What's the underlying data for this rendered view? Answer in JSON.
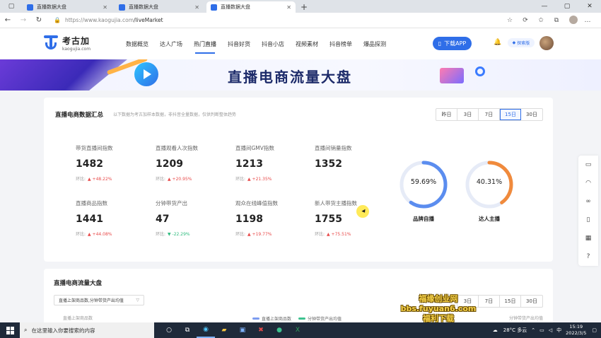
{
  "browser": {
    "tabs": [
      {
        "title": "直播数据大盘",
        "active": false
      },
      {
        "title": "直播数据大盘",
        "active": false
      },
      {
        "title": "直播数据大盘",
        "active": true
      }
    ],
    "url_host": "https://www.kaogujia.com",
    "url_path": "/liveMarket"
  },
  "site": {
    "logo_cn": "考古加",
    "logo_en": "kaogujia.com",
    "nav": [
      {
        "label": "数据概览",
        "active": false
      },
      {
        "label": "达人广场",
        "active": false
      },
      {
        "label": "热门直播",
        "active": true
      },
      {
        "label": "抖音好货",
        "active": false
      },
      {
        "label": "抖音小店",
        "active": false
      },
      {
        "label": "视频素材",
        "active": false
      },
      {
        "label": "抖音榜单",
        "active": false
      },
      {
        "label": "爆品探测",
        "active": false
      }
    ],
    "download_label": "下载APP",
    "vip_label": "探索版"
  },
  "banner": {
    "title": "直播电商流量大盘"
  },
  "summary": {
    "title": "直播电商数据汇总",
    "note": "以下数据为考古加样本数据，非抖音全量数据，仅供判断整体趋势",
    "ranges": [
      {
        "label": "昨日",
        "on": false
      },
      {
        "label": "3日",
        "on": false
      },
      {
        "label": "7日",
        "on": false
      },
      {
        "label": "15日",
        "on": true
      },
      {
        "label": "30日",
        "on": false
      }
    ],
    "metrics": [
      {
        "label": "带货直播间指数",
        "value": "1482",
        "chg_label": "环比:",
        "dir": "up",
        "chg": "▲ +48.22%"
      },
      {
        "label": "直播观看人次指数",
        "value": "1209",
        "chg_label": "环比:",
        "dir": "up",
        "chg": "▲ +20.95%"
      },
      {
        "label": "直播间GMV指数",
        "value": "1213",
        "chg_label": "环比:",
        "dir": "up",
        "chg": "▲ +21.35%"
      },
      {
        "label": "直播间销量指数",
        "value": "1352",
        "chg_label": "",
        "dir": "up",
        "chg": ""
      },
      {
        "label": "直播商品指数",
        "value": "1441",
        "chg_label": "环比:",
        "dir": "up",
        "chg": "▲ +44.08%"
      },
      {
        "label": "分钟带货产出",
        "value": "47",
        "chg_label": "环比:",
        "dir": "down",
        "chg": "▼ -22.29%"
      },
      {
        "label": "观众在线峰值指数",
        "value": "1198",
        "chg_label": "环比:",
        "dir": "up",
        "chg": "▲ +19.77%"
      },
      {
        "label": "新人带货主播指数",
        "value": "1755",
        "chg_label": "环比:",
        "dir": "up",
        "chg": "▲ +75.51%"
      }
    ],
    "donuts": [
      {
        "pct_text": "59.69%",
        "pct": 59.69,
        "name": "品牌自播",
        "color": "#5b8def"
      },
      {
        "pct_text": "40.31%",
        "pct": 40.31,
        "name": "达人主播",
        "color": "#f08a3c"
      }
    ]
  },
  "flow": {
    "title": "直播电商流量大盘",
    "select_value": "直播上架商品数,分钟带货产出均值",
    "ranges": [
      "3日",
      "7日",
      "15日",
      "30日"
    ],
    "legend": [
      {
        "label": "直播上架商品数",
        "color": "#7d9cf0"
      },
      {
        "label": "分钟带货产出均值",
        "color": "#3ec28f"
      }
    ],
    "y_left": "直播上架商品数",
    "y_right": "分钟带货产出均值"
  },
  "watermark": {
    "line1": "福缘创业网",
    "line2": "bbs.fuyuan6.com",
    "line3": "福利下载"
  },
  "taskbar": {
    "search_placeholder": "在这里输入你要搜索的内容",
    "weather": "28°C 多云",
    "ime": "中",
    "time": "15:19",
    "date": "2022/3/5"
  }
}
